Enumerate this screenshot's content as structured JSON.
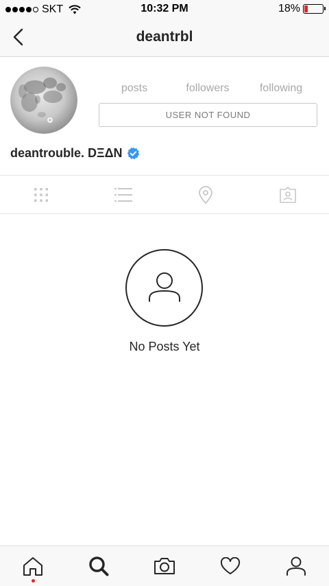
{
  "status_bar": {
    "carrier": "SKT",
    "time": "10:32 PM",
    "battery_percent": "18%",
    "battery_level": 0.18,
    "signal_bars": 4,
    "signal_total": 5,
    "battery_color": "#e0262b"
  },
  "header": {
    "title": "deantrbl",
    "back_icon": "chevron-left-icon"
  },
  "profile": {
    "stats": {
      "posts": "posts",
      "followers": "followers",
      "following": "following"
    },
    "action_button": "USER NOT FOUND",
    "display_name": "deantrouble. DΞΔN",
    "verified": true,
    "verified_color": "#3897f0"
  },
  "tabs": [
    {
      "name": "grid-view",
      "icon": "grid-icon"
    },
    {
      "name": "list-view",
      "icon": "list-icon"
    },
    {
      "name": "map-view",
      "icon": "location-pin-icon"
    },
    {
      "name": "tagged-view",
      "icon": "tagged-user-icon"
    }
  ],
  "empty_state": {
    "icon": "person-icon",
    "message": "No Posts Yet"
  },
  "bottom_nav": [
    {
      "name": "home",
      "icon": "home-icon",
      "notification": true
    },
    {
      "name": "search",
      "icon": "search-icon",
      "active": true
    },
    {
      "name": "camera",
      "icon": "camera-icon"
    },
    {
      "name": "activity",
      "icon": "heart-icon"
    },
    {
      "name": "profile",
      "icon": "profile-icon"
    }
  ],
  "colors": {
    "notification_dot": "#e0262b",
    "text": "#262626",
    "muted": "#a8a8a8"
  }
}
